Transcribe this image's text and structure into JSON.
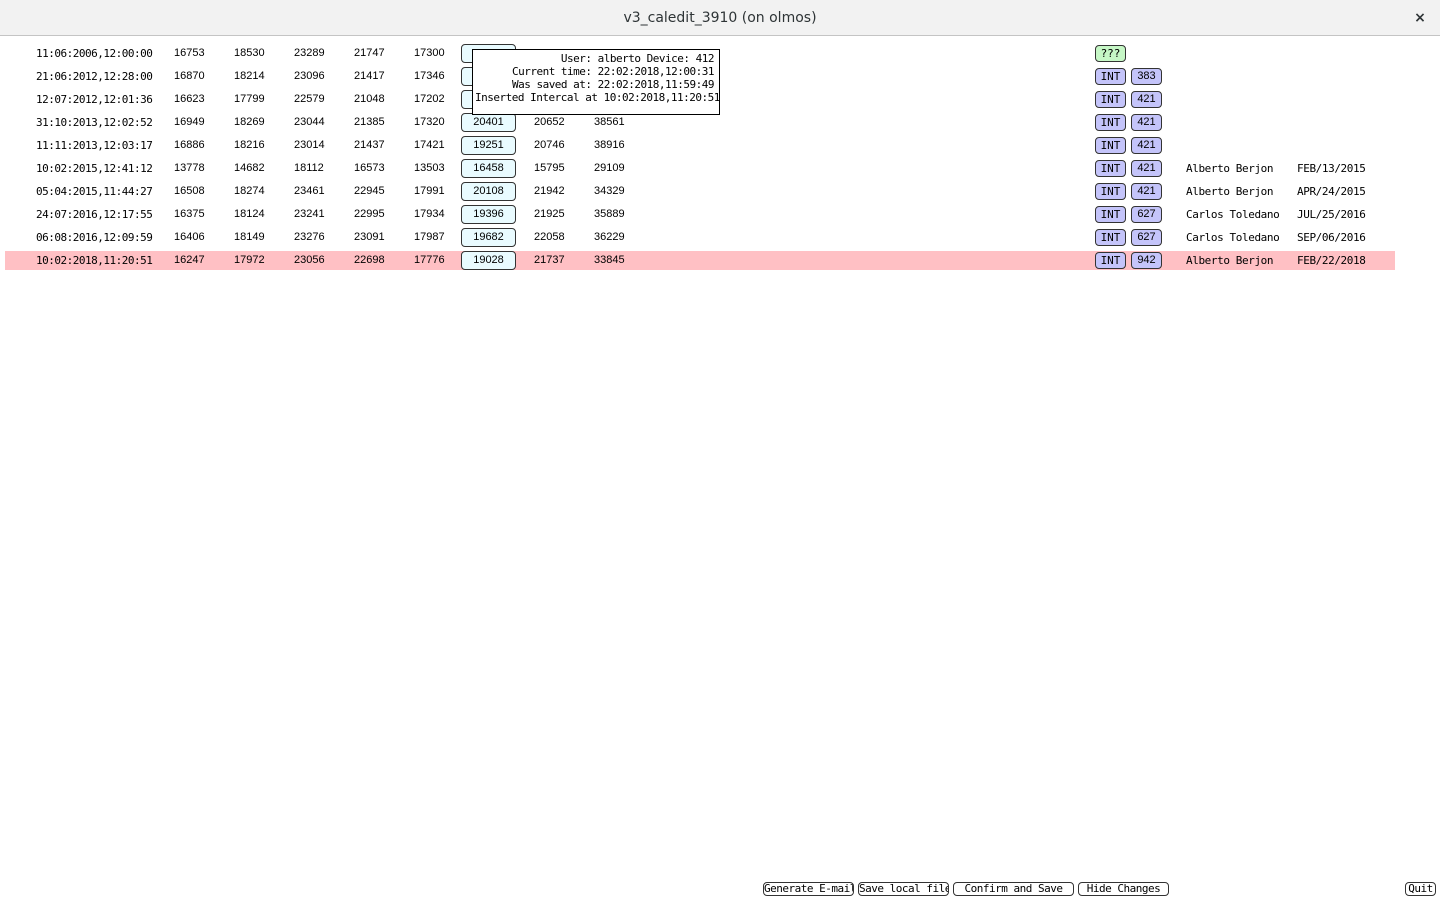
{
  "window": {
    "title": "v3_caledit_3910 (on olmos)",
    "close_glyph": "×"
  },
  "rows": [
    {
      "timestamp": "11:06:2006,12:00:00",
      "v1": "16753",
      "v2": "18530",
      "v3": "23289",
      "v4": "21747",
      "v5": "17300",
      "box": "",
      "v7": "",
      "v8": "",
      "tag": "???",
      "device": "",
      "user": "",
      "date": ""
    },
    {
      "timestamp": "21:06:2012,12:28:00",
      "v1": "16870",
      "v2": "18214",
      "v3": "23096",
      "v4": "21417",
      "v5": "17346",
      "box": "",
      "v7": "",
      "v8": "",
      "tag": "INT",
      "device": "383",
      "user": "",
      "date": ""
    },
    {
      "timestamp": "12:07:2012,12:01:36",
      "v1": "16623",
      "v2": "17799",
      "v3": "22579",
      "v4": "21048",
      "v5": "17202",
      "box": "",
      "v7": "",
      "v8": "",
      "tag": "INT",
      "device": "421",
      "user": "",
      "date": ""
    },
    {
      "timestamp": "31:10:2013,12:02:52",
      "v1": "16949",
      "v2": "18269",
      "v3": "23044",
      "v4": "21385",
      "v5": "17320",
      "box": "20401",
      "v7": "20652",
      "v8": "38561",
      "tag": "INT",
      "device": "421",
      "user": "",
      "date": ""
    },
    {
      "timestamp": "11:11:2013,12:03:17",
      "v1": "16886",
      "v2": "18216",
      "v3": "23014",
      "v4": "21437",
      "v5": "17421",
      "box": "19251",
      "v7": "20746",
      "v8": "38916",
      "tag": "INT",
      "device": "421",
      "user": "",
      "date": ""
    },
    {
      "timestamp": "10:02:2015,12:41:12",
      "v1": "13778",
      "v2": "14682",
      "v3": "18112",
      "v4": "16573",
      "v5": "13503",
      "box": "16458",
      "v7": "15795",
      "v8": "29109",
      "tag": "INT",
      "device": "421",
      "user": "Alberto Berjon",
      "date": "FEB/13/2015"
    },
    {
      "timestamp": "05:04:2015,11:44:27",
      "v1": "16508",
      "v2": "18274",
      "v3": "23461",
      "v4": "22945",
      "v5": "17991",
      "box": "20108",
      "v7": "21942",
      "v8": "34329",
      "tag": "INT",
      "device": "421",
      "user": "Alberto Berjon",
      "date": "APR/24/2015"
    },
    {
      "timestamp": "24:07:2016,12:17:55",
      "v1": "16375",
      "v2": "18124",
      "v3": "23241",
      "v4": "22995",
      "v5": "17934",
      "box": "19396",
      "v7": "21925",
      "v8": "35889",
      "tag": "INT",
      "device": "627",
      "user": "Carlos Toledano",
      "date": "JUL/25/2016"
    },
    {
      "timestamp": "06:08:2016,12:09:59",
      "v1": "16406",
      "v2": "18149",
      "v3": "23276",
      "v4": "23091",
      "v5": "17987",
      "box": "19682",
      "v7": "22058",
      "v8": "36229",
      "tag": "INT",
      "device": "627",
      "user": "Carlos Toledano",
      "date": "SEP/06/2016"
    },
    {
      "timestamp": "10:02:2018,11:20:51",
      "v1": "16247",
      "v2": "17972",
      "v3": "23056",
      "v4": "22698",
      "v5": "17776",
      "box": "19028",
      "v7": "21737",
      "v8": "33845",
      "tag": "INT",
      "device": "942",
      "user": "Alberto Berjon",
      "date": "FEB/22/2018",
      "selected": true
    }
  ],
  "tooltip": {
    "line1": "User: alberto Device: 412",
    "line2": "Current time: 22:02:2018,12:00:31",
    "line3": "Was saved at: 22:02:2018,11:59:49",
    "line4": "Inserted Intercal at 10:02:2018,11:20:51"
  },
  "buttons": {
    "email": "Generate E-mail",
    "save_local": "Save local file",
    "confirm": "Confirm and Save",
    "hide": "Hide Changes",
    "quit": "Quit"
  },
  "colors": {
    "selected_row": "#ffc0c4",
    "value_box": "#e9fbff",
    "int_tag": "#c4c4fa",
    "unknown_tag": "#c6f7c6"
  }
}
